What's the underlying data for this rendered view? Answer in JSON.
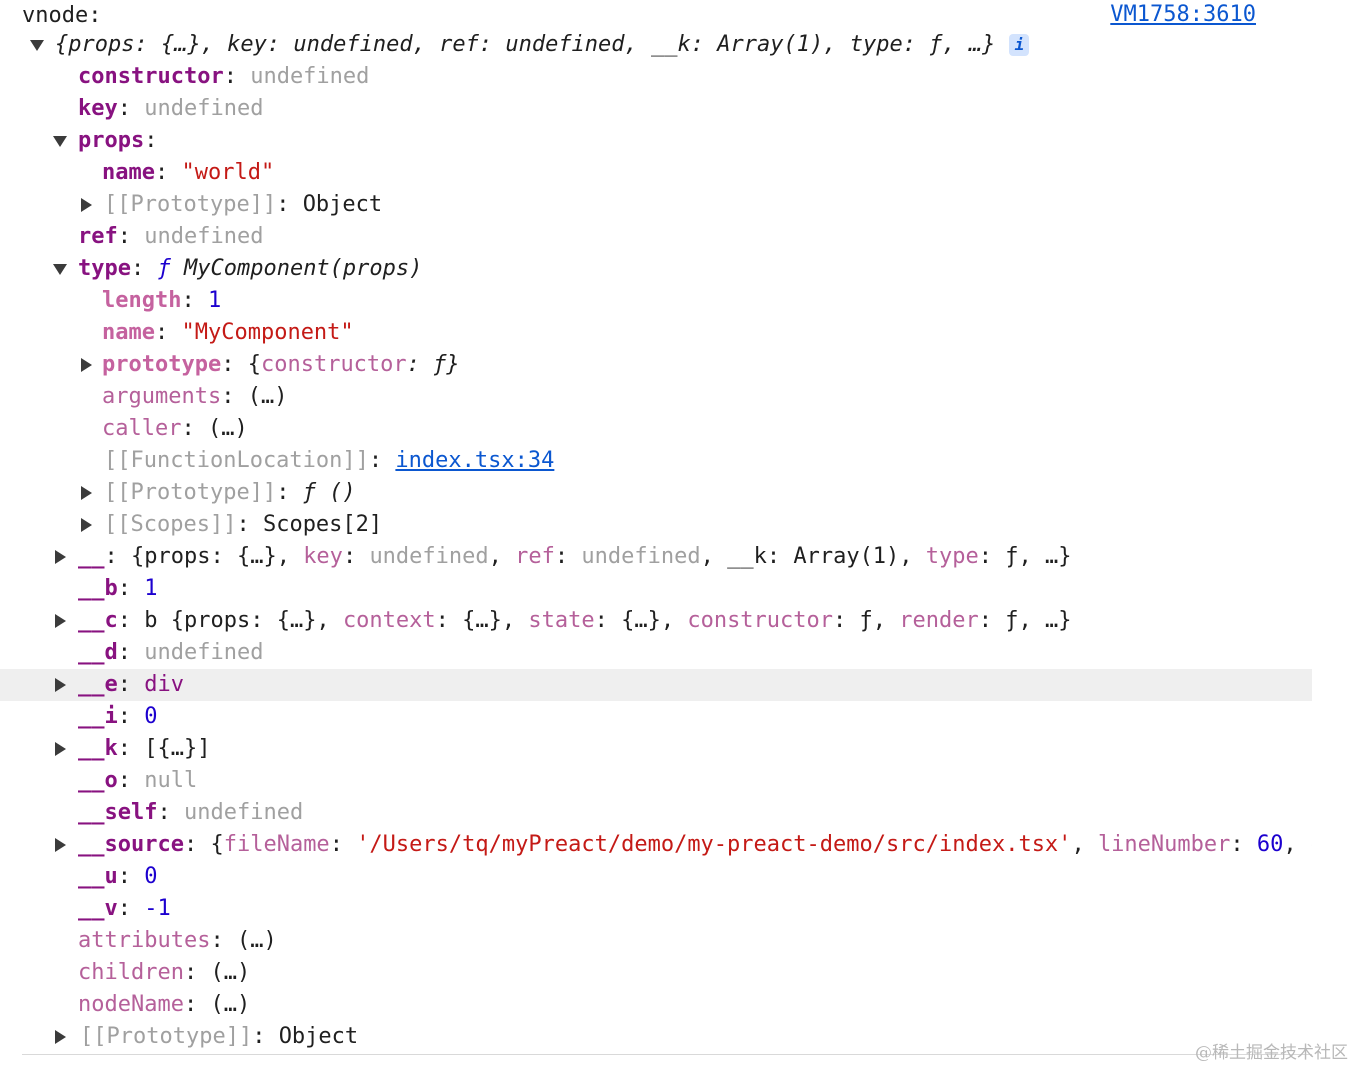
{
  "header": {
    "label": "vnode:",
    "source_link": "VM1758:3610"
  },
  "summary": {
    "text": "{props: {…}, key: undefined, ref: undefined, __k: Array(1), type: ƒ, …}",
    "info_badge": "i"
  },
  "rows": [
    {
      "key": "constructor",
      "value": "undefined"
    },
    {
      "key": "key",
      "value": "undefined"
    },
    {
      "key": "props",
      "value": ""
    },
    {
      "key": "name",
      "value": "\"world\""
    },
    {
      "key": "[[Prototype]]",
      "value": "Object"
    },
    {
      "key": "ref",
      "value": "undefined"
    },
    {
      "key": "type",
      "value_prefix": "ƒ",
      "value": "MyComponent(props)"
    },
    {
      "key": "length",
      "value": "1"
    },
    {
      "key": "name",
      "value": "\"MyComponent\""
    },
    {
      "key": "prototype",
      "value_a": "{",
      "value_b": "constructor",
      "value_c": ": ƒ}"
    },
    {
      "key": "arguments",
      "value": "(…)"
    },
    {
      "key": "caller",
      "value": "(…)"
    },
    {
      "key": "[[FunctionLocation]]",
      "value": "index.tsx:34"
    },
    {
      "key": "[[Prototype]]",
      "value": "ƒ ()"
    },
    {
      "key": "[[Scopes]]",
      "value": "Scopes[2]"
    },
    {
      "key": "__",
      "value_a": "{props: {…}, ",
      "value_b": "key",
      "value_c": ": ",
      "value_d": "undefined",
      "value_e": ", ",
      "value_f": "ref",
      "value_g": ": ",
      "value_h": "undefined",
      "value_i": ", __k: Array(1), ",
      "value_j": "type",
      "value_k": ": ƒ, …}"
    },
    {
      "key": "__b",
      "value": "1"
    },
    {
      "key": "__c",
      "value_a": "b {props: {…}, ",
      "value_b": "context",
      "value_c": ": {…}, ",
      "value_d": "state",
      "value_e": ": {…}, ",
      "value_f": "constructor",
      "value_g": ": ƒ, ",
      "value_h": "render",
      "value_i": ": ƒ, …}"
    },
    {
      "key": "__d",
      "value": "undefined"
    },
    {
      "key": "__e",
      "value": "div"
    },
    {
      "key": "__i",
      "value": "0"
    },
    {
      "key": "__k",
      "value": "[{…}]"
    },
    {
      "key": "__o",
      "value": "null"
    },
    {
      "key": "__self",
      "value": "undefined"
    },
    {
      "key": "__source",
      "value_a": "{",
      "value_b": "fileName",
      "value_c": ": ",
      "value_d": "'/Users/tq/myPreact/demo/my-preact-demo/src/index.tsx'",
      "value_e": ", ",
      "value_f": "lineNumber",
      "value_g": ": ",
      "value_h": "60",
      "value_i": ", c"
    },
    {
      "key": "__u",
      "value": "0"
    },
    {
      "key": "__v",
      "value": "-1"
    },
    {
      "key": "attributes",
      "value": "(…)"
    },
    {
      "key": "children",
      "value": "(…)"
    },
    {
      "key": "nodeName",
      "value": "(…)"
    },
    {
      "key": "[[Prototype]]",
      "value": "Object"
    }
  ],
  "watermark": "@稀土掘金技术社区"
}
